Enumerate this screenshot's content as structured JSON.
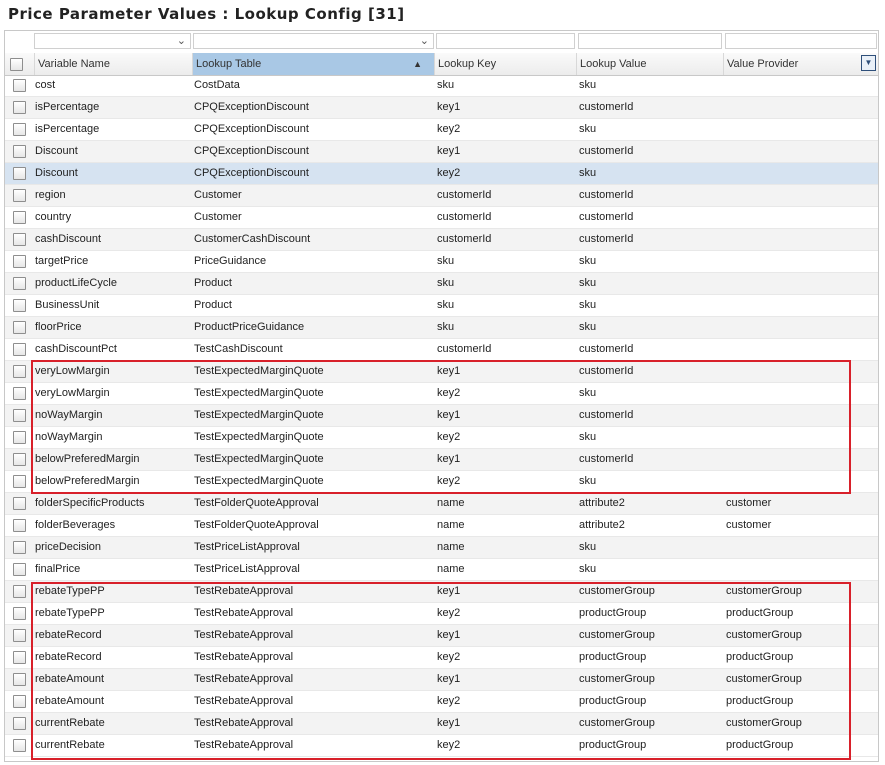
{
  "title": "Price Parameter Values : Lookup Config [31]",
  "columns": {
    "variable": "Variable Name",
    "table": "Lookup Table",
    "key": "Lookup Key",
    "value": "Lookup Value",
    "provider": "Value Provider"
  },
  "sort_indicator": "▲",
  "menu_icon": "▼",
  "filter_dropdown_icon": "⌄",
  "highlight_color": "#d8202a",
  "rows": [
    {
      "variable": "cost",
      "table": "CostData",
      "key": "sku",
      "value": "sku",
      "provider": ""
    },
    {
      "variable": "isPercentage",
      "table": "CPQExceptionDiscount",
      "key": "key1",
      "value": "customerId",
      "provider": ""
    },
    {
      "variable": "isPercentage",
      "table": "CPQExceptionDiscount",
      "key": "key2",
      "value": "sku",
      "provider": ""
    },
    {
      "variable": "Discount",
      "table": "CPQExceptionDiscount",
      "key": "key1",
      "value": "customerId",
      "provider": ""
    },
    {
      "variable": "Discount",
      "table": "CPQExceptionDiscount",
      "key": "key2",
      "value": "sku",
      "provider": "",
      "selected": true
    },
    {
      "variable": "region",
      "table": "Customer",
      "key": "customerId",
      "value": "customerId",
      "provider": ""
    },
    {
      "variable": "country",
      "table": "Customer",
      "key": "customerId",
      "value": "customerId",
      "provider": ""
    },
    {
      "variable": "cashDiscount",
      "table": "CustomerCashDiscount",
      "key": "customerId",
      "value": "customerId",
      "provider": ""
    },
    {
      "variable": "targetPrice",
      "table": "PriceGuidance",
      "key": "sku",
      "value": "sku",
      "provider": ""
    },
    {
      "variable": "productLifeCycle",
      "table": "Product",
      "key": "sku",
      "value": "sku",
      "provider": ""
    },
    {
      "variable": "BusinessUnit",
      "table": "Product",
      "key": "sku",
      "value": "sku",
      "provider": ""
    },
    {
      "variable": "floorPrice",
      "table": "ProductPriceGuidance",
      "key": "sku",
      "value": "sku",
      "provider": ""
    },
    {
      "variable": "cashDiscountPct",
      "table": "TestCashDiscount",
      "key": "customerId",
      "value": "customerId",
      "provider": ""
    },
    {
      "variable": "veryLowMargin",
      "table": "TestExpectedMarginQuote",
      "key": "key1",
      "value": "customerId",
      "provider": ""
    },
    {
      "variable": "veryLowMargin",
      "table": "TestExpectedMarginQuote",
      "key": "key2",
      "value": "sku",
      "provider": ""
    },
    {
      "variable": "noWayMargin",
      "table": "TestExpectedMarginQuote",
      "key": "key1",
      "value": "customerId",
      "provider": ""
    },
    {
      "variable": "noWayMargin",
      "table": "TestExpectedMarginQuote",
      "key": "key2",
      "value": "sku",
      "provider": ""
    },
    {
      "variable": "belowPreferedMargin",
      "table": "TestExpectedMarginQuote",
      "key": "key1",
      "value": "customerId",
      "provider": ""
    },
    {
      "variable": "belowPreferedMargin",
      "table": "TestExpectedMarginQuote",
      "key": "key2",
      "value": "sku",
      "provider": ""
    },
    {
      "variable": "folderSpecificProducts",
      "table": "TestFolderQuoteApproval",
      "key": "name",
      "value": "attribute2",
      "provider": "customer"
    },
    {
      "variable": "folderBeverages",
      "table": "TestFolderQuoteApproval",
      "key": "name",
      "value": "attribute2",
      "provider": "customer"
    },
    {
      "variable": "priceDecision",
      "table": "TestPriceListApproval",
      "key": "name",
      "value": "sku",
      "provider": ""
    },
    {
      "variable": "finalPrice",
      "table": "TestPriceListApproval",
      "key": "name",
      "value": "sku",
      "provider": ""
    },
    {
      "variable": "rebateTypePP",
      "table": "TestRebateApproval",
      "key": "key1",
      "value": "customerGroup",
      "provider": "customerGroup"
    },
    {
      "variable": "rebateTypePP",
      "table": "TestRebateApproval",
      "key": "key2",
      "value": "productGroup",
      "provider": "productGroup"
    },
    {
      "variable": "rebateRecord",
      "table": "TestRebateApproval",
      "key": "key1",
      "value": "customerGroup",
      "provider": "customerGroup"
    },
    {
      "variable": "rebateRecord",
      "table": "TestRebateApproval",
      "key": "key2",
      "value": "productGroup",
      "provider": "productGroup"
    },
    {
      "variable": "rebateAmount",
      "table": "TestRebateApproval",
      "key": "key1",
      "value": "customerGroup",
      "provider": "customerGroup"
    },
    {
      "variable": "rebateAmount",
      "table": "TestRebateApproval",
      "key": "key2",
      "value": "productGroup",
      "provider": "productGroup"
    },
    {
      "variable": "currentRebate",
      "table": "TestRebateApproval",
      "key": "key1",
      "value": "customerGroup",
      "provider": "customerGroup"
    },
    {
      "variable": "currentRebate",
      "table": "TestRebateApproval",
      "key": "key2",
      "value": "productGroup",
      "provider": "productGroup"
    }
  ]
}
